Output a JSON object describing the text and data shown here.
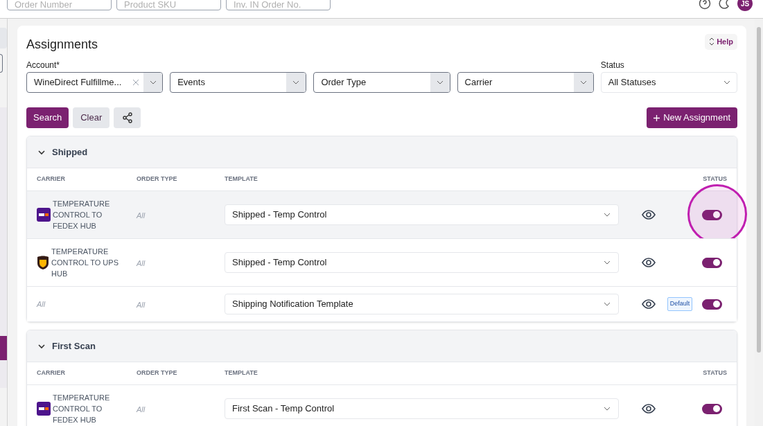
{
  "top_bar": {
    "search_fields": [
      {
        "placeholder": "Order Number"
      },
      {
        "placeholder": "Product SKU"
      },
      {
        "placeholder": "Inv. IN Order No."
      }
    ],
    "avatar": "JS"
  },
  "page": {
    "title": "Assignments",
    "help": "Help",
    "filters": [
      {
        "label": "Account*",
        "value": "WineDirect Fulfillme...",
        "clearable": true,
        "kind": "combo"
      },
      {
        "placeholder": "Events",
        "kind": "combo"
      },
      {
        "placeholder": "Order Type",
        "kind": "combo"
      },
      {
        "placeholder": "Carrier",
        "kind": "combo"
      },
      {
        "label": "Status",
        "value": "All Statuses",
        "kind": "dropdown"
      }
    ],
    "buttons": {
      "search": "Search",
      "clear": "Clear",
      "new": "New Assignment"
    },
    "sections": [
      {
        "title": "Shipped",
        "expanded": true,
        "columns": [
          "CARRIER",
          "ORDER TYPE",
          "TEMPLATE",
          "STATUS"
        ],
        "rows": [
          {
            "kind": "fedex",
            "carrier": "TEMPERATURE CONTROL TO FEDEX HUB",
            "order_type": "All",
            "template": "Shipped - Temp Control",
            "on": true,
            "highlighted": true,
            "annotated": true
          },
          {
            "kind": "ups",
            "carrier": "TEMPERATURE CONTROL TO UPS HUB",
            "order_type": "All",
            "template": "Shipped - Temp Control",
            "on": true,
            "highlighted": false,
            "annotated": false
          },
          {
            "kind": "any",
            "carrier": "All",
            "order_type": "All",
            "template": "Shipping Notification Template",
            "badge": "Default",
            "on": true,
            "highlighted": false,
            "annotated": false
          }
        ]
      },
      {
        "title": "First Scan",
        "expanded": true,
        "columns": [
          "CARRIER",
          "ORDER TYPE",
          "TEMPLATE",
          "STATUS"
        ],
        "rows": [
          {
            "kind": "fedex",
            "carrier": "TEMPERATURE CONTROL TO FEDEX HUB",
            "order_type": "All",
            "template": "First Scan - Temp Control",
            "on": true,
            "highlighted": false,
            "annotated": false
          }
        ]
      }
    ]
  }
}
